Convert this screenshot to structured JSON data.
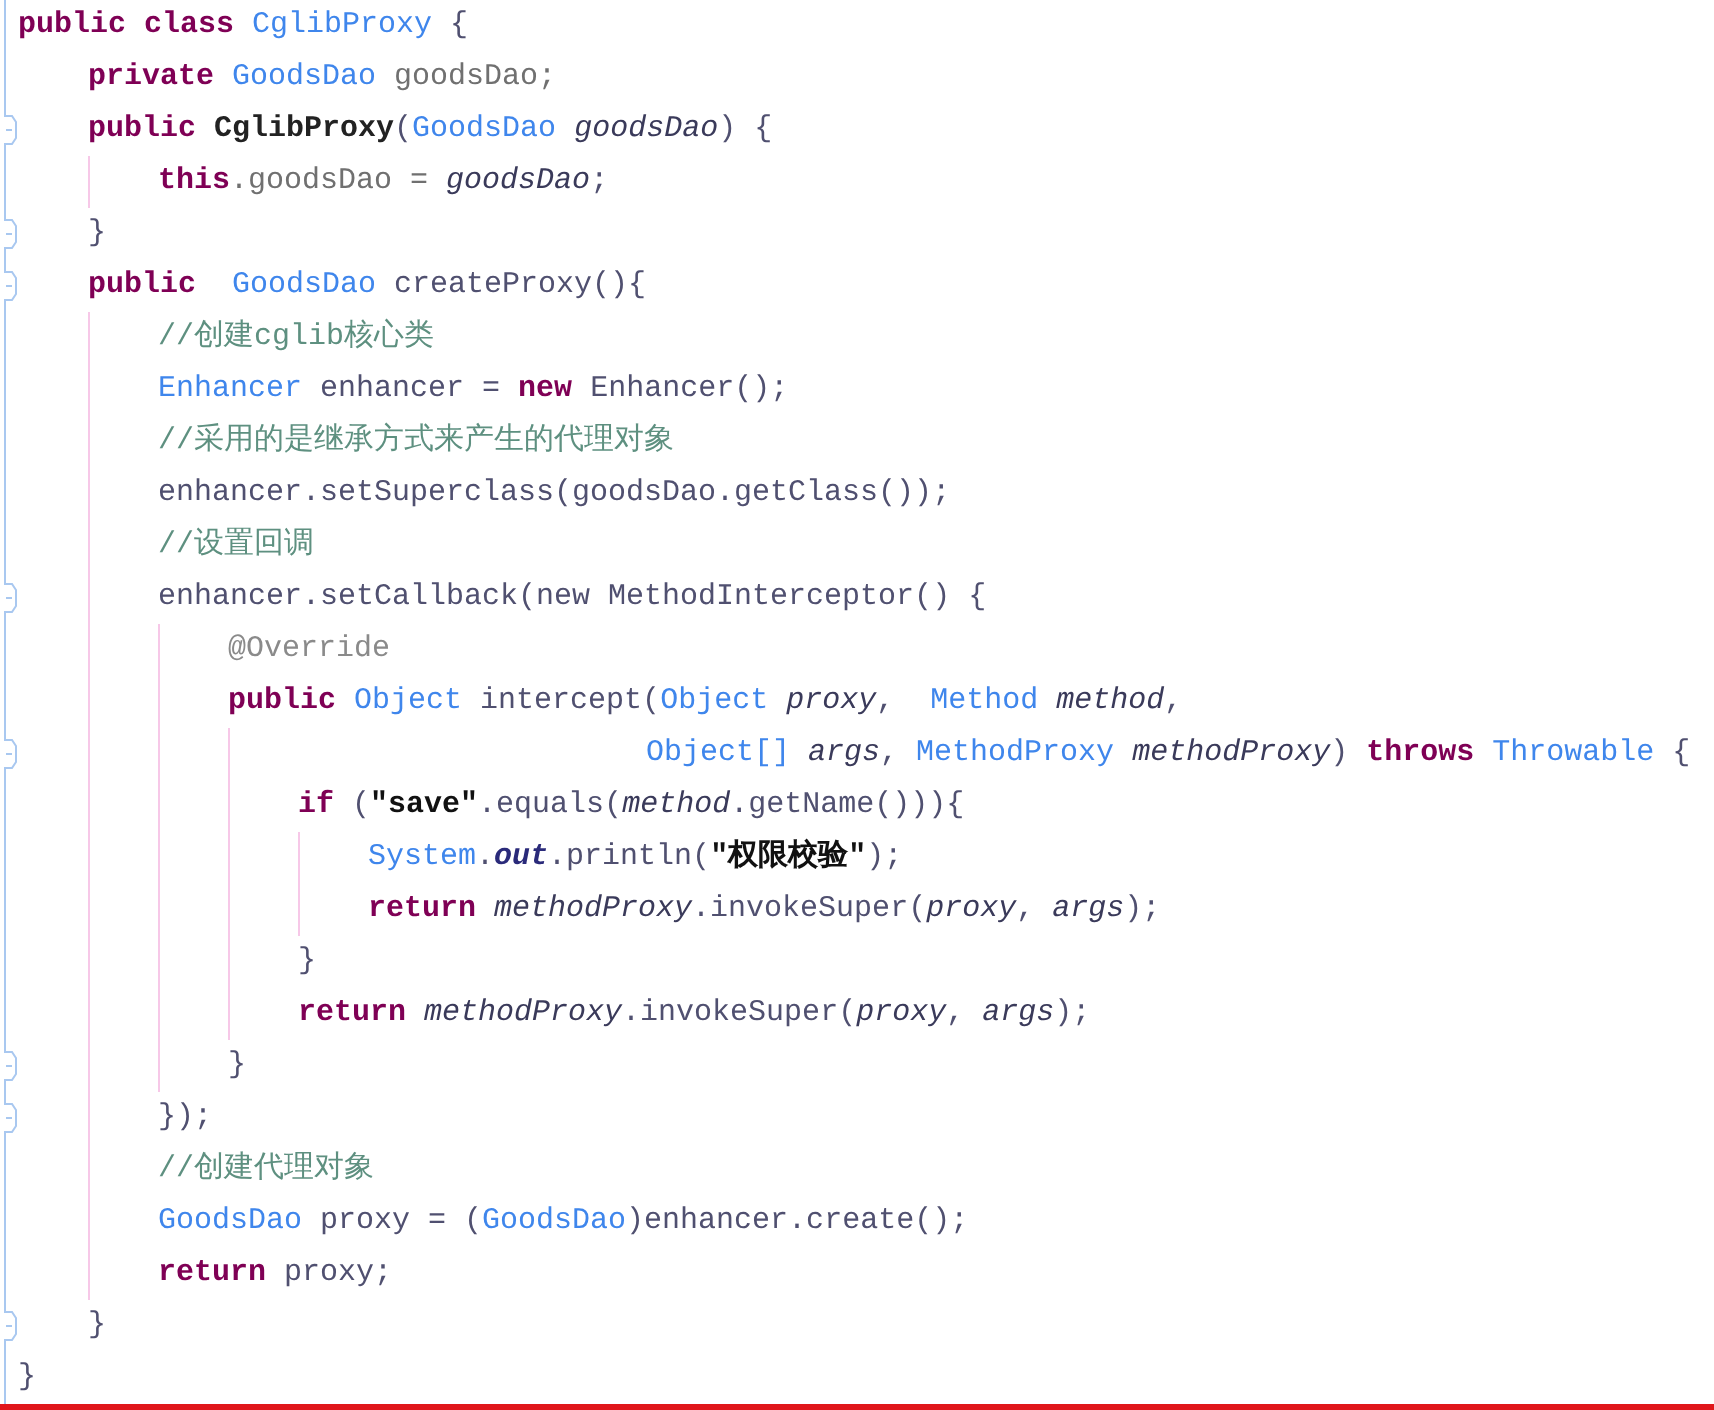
{
  "editor": {
    "lines": [
      {
        "fold": false,
        "tokens": [
          {
            "kind": "keyword",
            "text": "public class "
          },
          {
            "kind": "type",
            "text": "CglibProxy"
          },
          {
            "kind": "plain",
            "text": " {"
          }
        ],
        "children": [
          {
            "fold": false,
            "tokens": [
              {
                "kind": "keyword",
                "text": "private "
              },
              {
                "kind": "type",
                "text": "GoodsDao"
              },
              {
                "kind": "field",
                "text": " goodsDao;"
              }
            ]
          },
          {
            "fold": true,
            "tokens": [
              {
                "kind": "keyword",
                "text": "public "
              },
              {
                "kind": "declaration",
                "text": "CglibProxy"
              },
              {
                "kind": "plain",
                "text": "("
              },
              {
                "kind": "type",
                "text": "GoodsDao "
              },
              {
                "kind": "param",
                "text": "goodsDao"
              },
              {
                "kind": "plain",
                "text": ") {"
              }
            ],
            "children": [
              {
                "fold": false,
                "tokens": [
                  {
                    "kind": "keyword",
                    "text": "this"
                  },
                  {
                    "kind": "field",
                    "text": ".goodsDao = "
                  },
                  {
                    "kind": "param",
                    "text": "goodsDao"
                  },
                  {
                    "kind": "plain",
                    "text": ";"
                  }
                ]
              }
            ]
          },
          {
            "fold": true,
            "tokens": [
              {
                "kind": "plain",
                "text": "}"
              }
            ]
          },
          {
            "fold": true,
            "tokens": [
              {
                "kind": "keyword",
                "text": "public  "
              },
              {
                "kind": "type",
                "text": "GoodsDao"
              },
              {
                "kind": "plain",
                "text": " createProxy(){"
              }
            ],
            "children": [
              {
                "fold": false,
                "tokens": [
                  {
                    "kind": "comment",
                    "text": "//创建cglib核心类"
                  }
                ]
              },
              {
                "fold": false,
                "tokens": [
                  {
                    "kind": "type",
                    "text": "Enhancer"
                  },
                  {
                    "kind": "plain",
                    "text": " enhancer = "
                  },
                  {
                    "kind": "keyword",
                    "text": "new"
                  },
                  {
                    "kind": "plain",
                    "text": " Enhancer();"
                  }
                ]
              },
              {
                "fold": false,
                "tokens": [
                  {
                    "kind": "comment",
                    "text": "//采用的是继承方式来产生的代理对象"
                  }
                ]
              },
              {
                "fold": false,
                "tokens": [
                  {
                    "kind": "plain",
                    "text": "enhancer.setSuperclass(goodsDao.getClass());"
                  }
                ]
              },
              {
                "fold": false,
                "tokens": [
                  {
                    "kind": "comment",
                    "text": "//设置回调"
                  }
                ]
              },
              {
                "fold": true,
                "tokens": [
                  {
                    "kind": "plain",
                    "text": "enhancer.setCallback(new MethodInterceptor() {"
                  }
                ],
                "children": [
                  {
                    "fold": false,
                    "tokens": [
                      {
                        "kind": "annotation",
                        "text": "@Override"
                      }
                    ]
                  },
                  {
                    "fold": false,
                    "tokens": [
                      {
                        "kind": "keyword",
                        "text": "public "
                      },
                      {
                        "kind": "type",
                        "text": "Object"
                      },
                      {
                        "kind": "plain",
                        "text": " intercept("
                      },
                      {
                        "kind": "type",
                        "text": "Object "
                      },
                      {
                        "kind": "param",
                        "text": "proxy"
                      },
                      {
                        "kind": "plain",
                        "text": ",  "
                      },
                      {
                        "kind": "type",
                        "text": "Method "
                      },
                      {
                        "kind": "param",
                        "text": "method"
                      },
                      {
                        "kind": "plain",
                        "text": ","
                      }
                    ],
                    "children": [
                      {
                        "fold": true,
                        "continuation": true,
                        "tokens": [
                          {
                            "kind": "type",
                            "text": "Object[] "
                          },
                          {
                            "kind": "param",
                            "text": "args"
                          },
                          {
                            "kind": "plain",
                            "text": ", "
                          },
                          {
                            "kind": "type",
                            "text": "MethodProxy "
                          },
                          {
                            "kind": "param",
                            "text": "methodProxy"
                          },
                          {
                            "kind": "plain",
                            "text": ") "
                          },
                          {
                            "kind": "keyword",
                            "text": "throws "
                          },
                          {
                            "kind": "type",
                            "text": "Throwable"
                          },
                          {
                            "kind": "plain",
                            "text": " {"
                          }
                        ]
                      },
                      {
                        "fold": false,
                        "tokens": [
                          {
                            "kind": "keyword",
                            "text": "if "
                          },
                          {
                            "kind": "plain",
                            "text": "("
                          },
                          {
                            "kind": "string",
                            "text": "\"save\""
                          },
                          {
                            "kind": "plain",
                            "text": ".equals("
                          },
                          {
                            "kind": "param",
                            "text": "method"
                          },
                          {
                            "kind": "plain",
                            "text": ".getName())){"
                          }
                        ],
                        "children": [
                          {
                            "fold": false,
                            "tokens": [
                              {
                                "kind": "type",
                                "text": "System"
                              },
                              {
                                "kind": "plain",
                                "text": "."
                              },
                              {
                                "kind": "static",
                                "text": "out"
                              },
                              {
                                "kind": "plain",
                                "text": ".println("
                              },
                              {
                                "kind": "string",
                                "text": "\"权限校验\""
                              },
                              {
                                "kind": "plain",
                                "text": ");"
                              }
                            ]
                          },
                          {
                            "fold": false,
                            "tokens": [
                              {
                                "kind": "keyword",
                                "text": "return "
                              },
                              {
                                "kind": "param",
                                "text": "methodProxy"
                              },
                              {
                                "kind": "plain",
                                "text": ".invokeSuper("
                              },
                              {
                                "kind": "param",
                                "text": "proxy"
                              },
                              {
                                "kind": "plain",
                                "text": ", "
                              },
                              {
                                "kind": "param",
                                "text": "args"
                              },
                              {
                                "kind": "plain",
                                "text": ");"
                              }
                            ]
                          }
                        ]
                      },
                      {
                        "fold": false,
                        "tokens": [
                          {
                            "kind": "plain",
                            "text": "}"
                          }
                        ]
                      },
                      {
                        "fold": false,
                        "tokens": [
                          {
                            "kind": "keyword",
                            "text": "return "
                          },
                          {
                            "kind": "param",
                            "text": "methodProxy"
                          },
                          {
                            "kind": "plain",
                            "text": ".invokeSuper("
                          },
                          {
                            "kind": "param",
                            "text": "proxy"
                          },
                          {
                            "kind": "plain",
                            "text": ", "
                          },
                          {
                            "kind": "param",
                            "text": "args"
                          },
                          {
                            "kind": "plain",
                            "text": ");"
                          }
                        ]
                      }
                    ]
                  },
                  {
                    "fold": true,
                    "tokens": [
                      {
                        "kind": "plain",
                        "text": "}"
                      }
                    ]
                  }
                ]
              },
              {
                "fold": true,
                "tokens": [
                  {
                    "kind": "plain",
                    "text": "});"
                  }
                ]
              },
              {
                "fold": false,
                "tokens": [
                  {
                    "kind": "comment",
                    "text": "//创建代理对象"
                  }
                ]
              },
              {
                "fold": false,
                "tokens": [
                  {
                    "kind": "type",
                    "text": "GoodsDao"
                  },
                  {
                    "kind": "plain",
                    "text": " proxy = ("
                  },
                  {
                    "kind": "type",
                    "text": "GoodsDao"
                  },
                  {
                    "kind": "plain",
                    "text": ")enhancer.create();"
                  }
                ]
              },
              {
                "fold": false,
                "tokens": [
                  {
                    "kind": "keyword",
                    "text": "return "
                  },
                  {
                    "kind": "plain",
                    "text": "proxy;"
                  }
                ]
              }
            ]
          },
          {
            "fold": true,
            "tokens": [
              {
                "kind": "plain",
                "text": "}"
              }
            ]
          }
        ]
      },
      {
        "fold": false,
        "tokens": [
          {
            "kind": "plain",
            "text": "}"
          }
        ]
      }
    ]
  }
}
